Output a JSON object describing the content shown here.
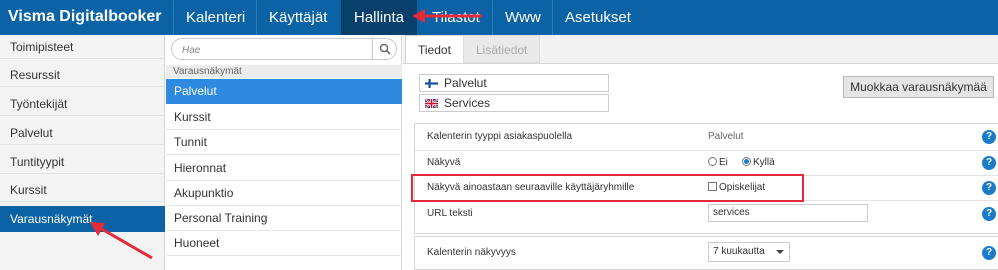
{
  "app": {
    "brand": "Visma Digitalbooker",
    "nav": [
      {
        "label": "Kalenteri"
      },
      {
        "label": "Käyttäjät"
      },
      {
        "label": "Hallinta"
      },
      {
        "label": "Tilastot"
      },
      {
        "label": "Www"
      },
      {
        "label": "Asetukset"
      }
    ]
  },
  "sidebar": {
    "items": [
      {
        "label": "Toimipisteet"
      },
      {
        "label": "Resurssit"
      },
      {
        "label": "Työntekijät"
      },
      {
        "label": "Palvelut"
      },
      {
        "label": "Tuntityypit"
      },
      {
        "label": "Kurssit"
      },
      {
        "label": "Varausnäkymät"
      }
    ]
  },
  "middle": {
    "search_placeholder": "Hae",
    "group_header": "Varausnäkymät",
    "items": [
      {
        "label": "Palvelut"
      },
      {
        "label": "Kurssit"
      },
      {
        "label": "Tunnit"
      },
      {
        "label": "Hieronnat"
      },
      {
        "label": "Akupunktio"
      },
      {
        "label": "Personal Training"
      },
      {
        "label": "Huoneet"
      }
    ]
  },
  "content": {
    "tabs": [
      {
        "label": "Tiedot"
      },
      {
        "label": "Lisätiedot"
      }
    ],
    "names": [
      {
        "flag": "finland-flag-icon",
        "value": "Palvelut"
      },
      {
        "flag": "uk-flag-icon",
        "value": "Services"
      }
    ],
    "edit_button": "Muokkaa varausnäkymää",
    "rows": {
      "type_label": "Kalenterin tyyppi asiakaspuolella",
      "type_value": "Palvelut",
      "visible_label": "Näkyvä",
      "visible_options": [
        "Ei",
        "Kyllä"
      ],
      "visible_selected": "Kyllä",
      "groups_label": "Näkyvä ainoastaan seuraaville käyttäjäryhmille",
      "groups_option": "Opiskelijat",
      "url_label": "URL teksti",
      "url_value": "services"
    },
    "calendar": {
      "label": "Kalenterin näkyvyys",
      "selected": "7 kuukautta"
    },
    "help_glyph": "?"
  },
  "colors": {
    "topbar": "#0b63a6",
    "active_nav": "#083f6b",
    "selected_item": "#2d8ae0",
    "help": "#1a7cc8",
    "annotation": "#e52b3a"
  }
}
